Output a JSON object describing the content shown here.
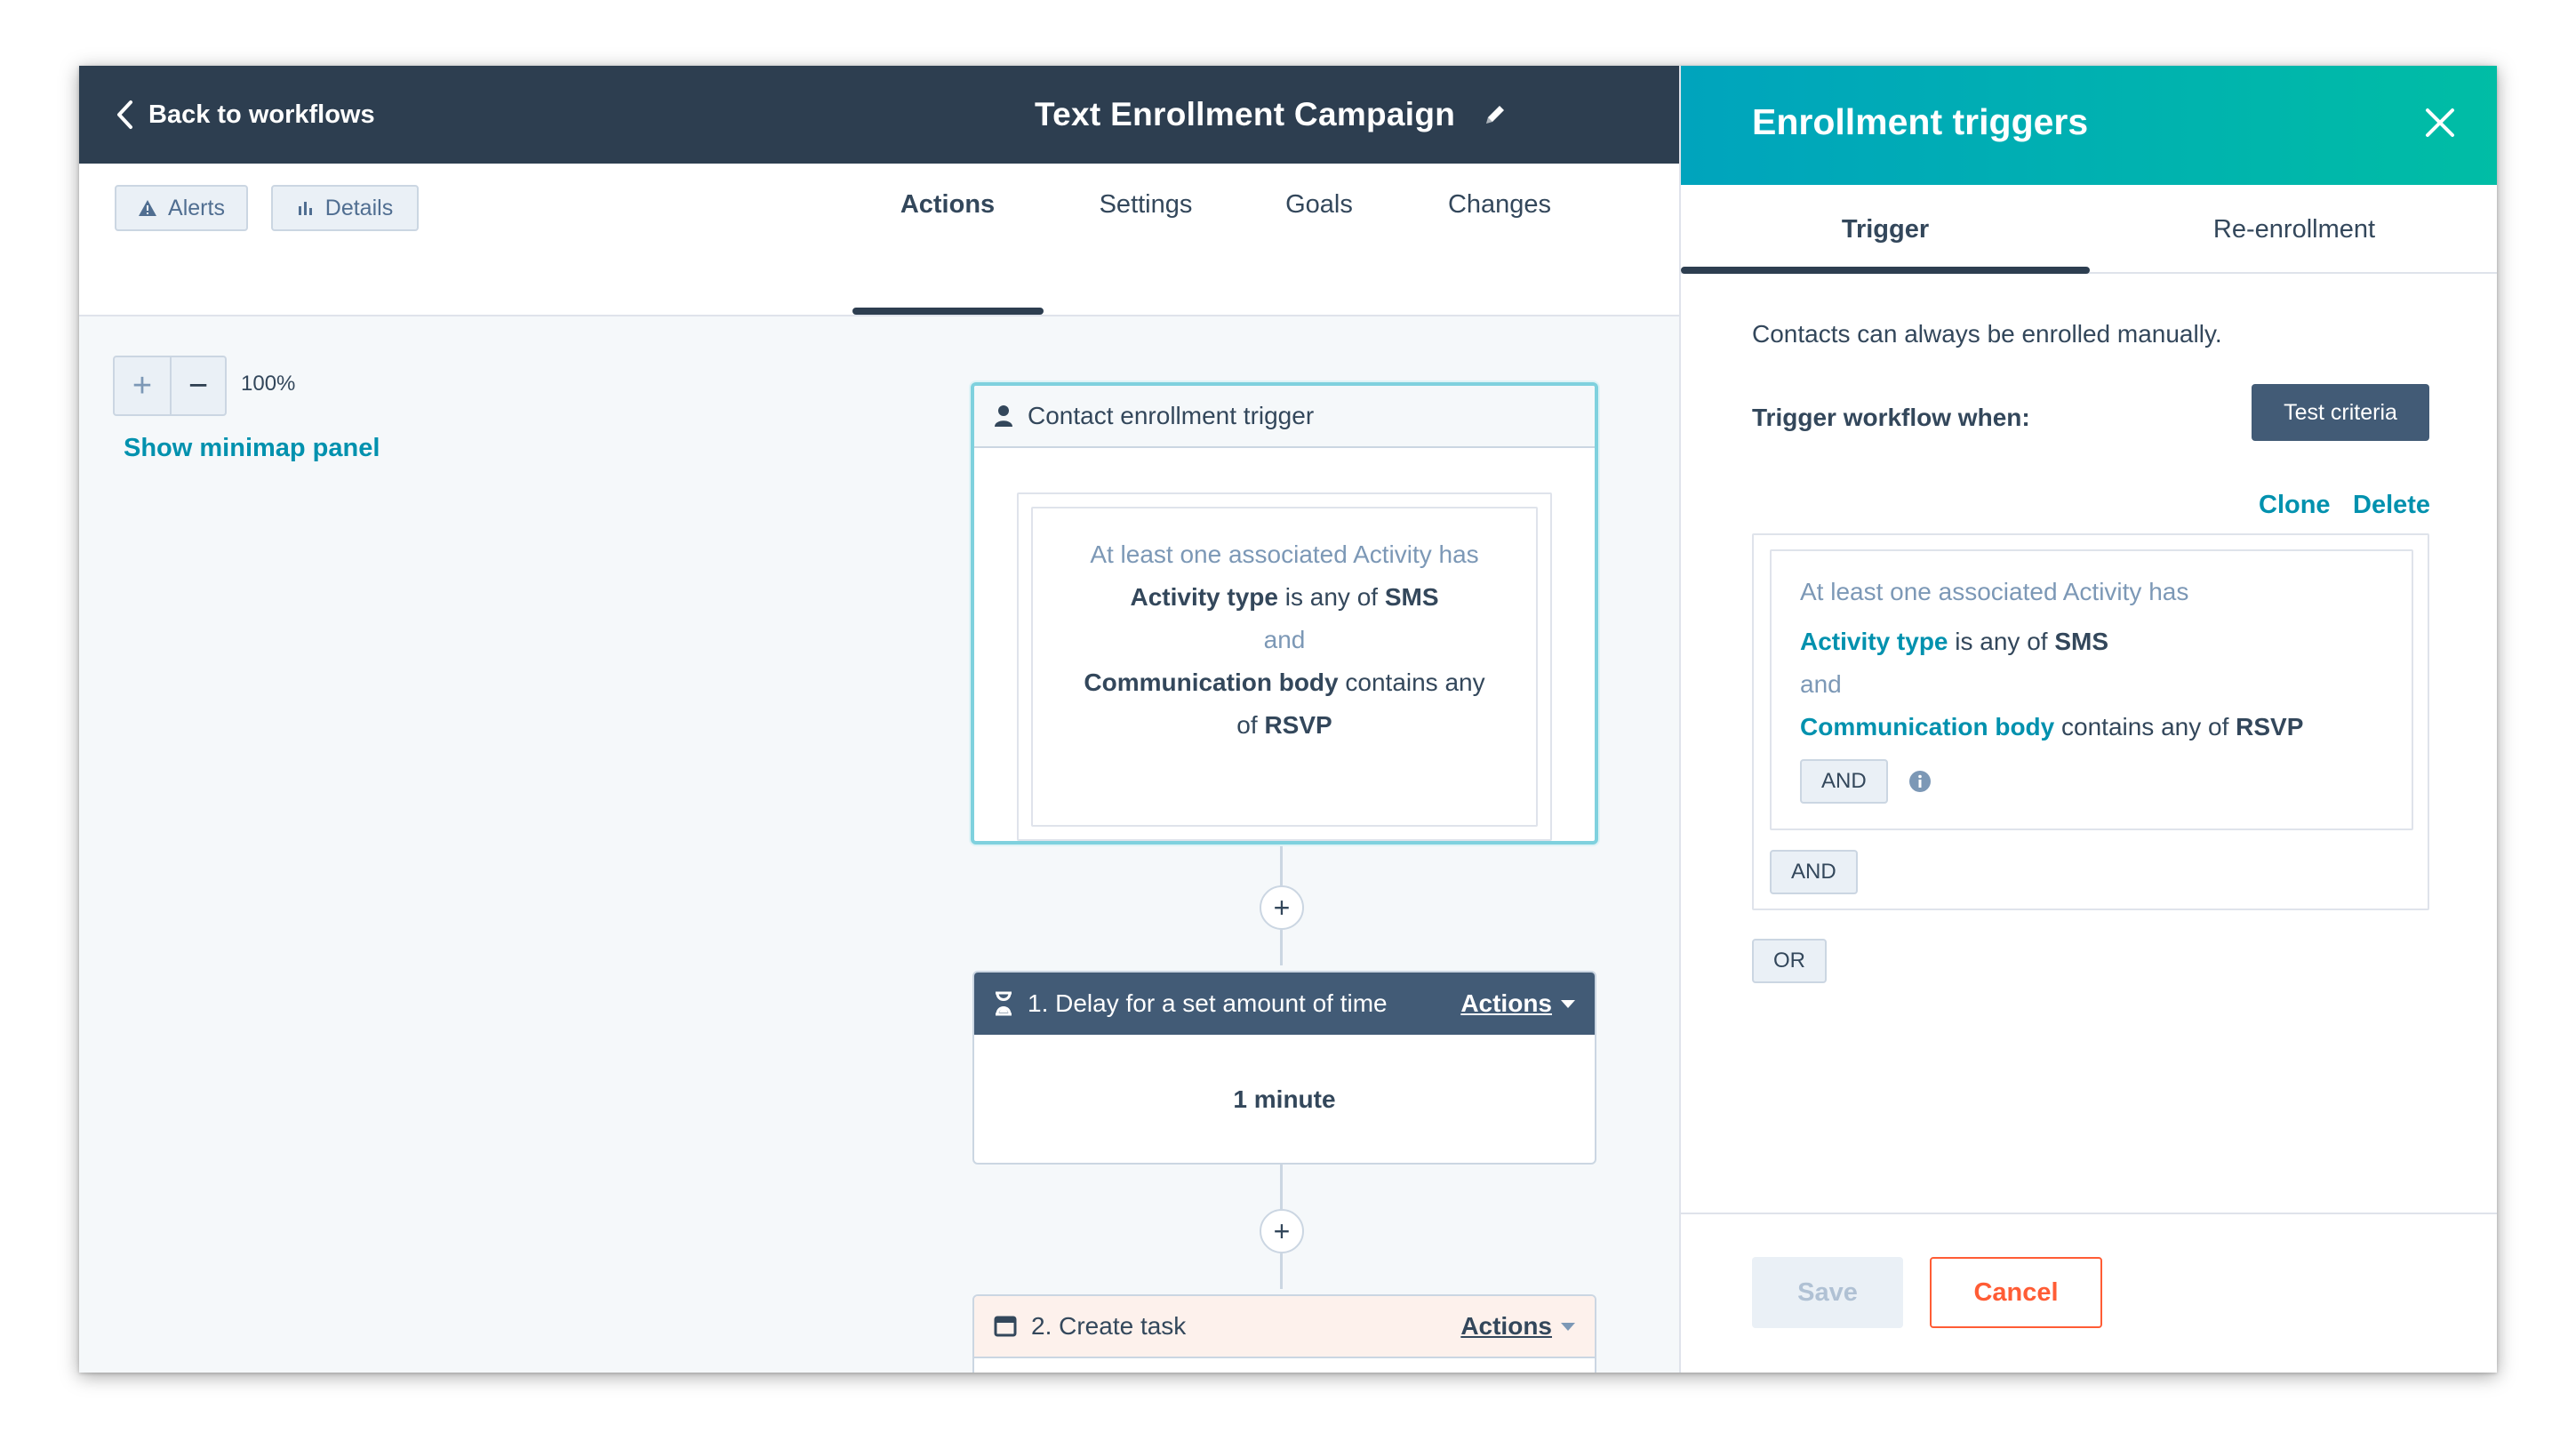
{
  "topbar": {
    "back_label": "Back to workflows",
    "title": "Text Enrollment Campaign"
  },
  "subheader": {
    "alerts_label": "Alerts",
    "details_label": "Details",
    "tabs": [
      "Actions",
      "Settings",
      "Goals",
      "Changes"
    ],
    "active_tab": "Actions"
  },
  "canvas": {
    "zoom_level": "100%",
    "minimap_link": "Show minimap panel",
    "trigger_card": {
      "title": "Contact enrollment trigger",
      "line1": "At least one associated Activity has",
      "prop1": "Activity type",
      "op1": " is any of ",
      "val1": "SMS",
      "and_label": "and",
      "prop2": "Communication body",
      "op2": " contains any",
      "op2b": "of ",
      "val2": "RSVP"
    },
    "delay_card": {
      "title": "1. Delay for a set amount of time",
      "actions_label": "Actions",
      "body": "1 minute"
    },
    "task_card": {
      "title": "2. Create task",
      "actions_label": "Actions"
    },
    "plus": "+"
  },
  "panel": {
    "title": "Enrollment triggers",
    "tabs": [
      "Trigger",
      "Re-enrollment"
    ],
    "active_tab": "Trigger",
    "manual_note": "Contacts can always be enrolled manually.",
    "trigger_when": "Trigger workflow when:",
    "test_button": "Test criteria",
    "clone_label": "Clone",
    "delete_label": "Delete",
    "criteria": {
      "line1": "At least one associated Activity has",
      "prop1": "Activity type",
      "op1": " is any of ",
      "val1": "SMS",
      "and_label": "and",
      "prop2": "Communication body",
      "op2": " contains any of ",
      "val2": "RSVP",
      "inner_and": "AND"
    },
    "group_and": "AND",
    "or_label": "OR",
    "save_label": "Save",
    "cancel_label": "Cancel"
  },
  "colors": {
    "topbar": "#2d3e50",
    "accent_teal": "#0091ae",
    "panel_gradient_start": "#00a4bd",
    "panel_gradient_end": "#00bda5",
    "cancel": "#ff5c35"
  },
  "icons": [
    "chevron-left-icon",
    "pencil-icon",
    "warning-icon",
    "bar-chart-icon",
    "person-icon",
    "hourglass-icon",
    "task-icon",
    "close-icon",
    "info-icon"
  ]
}
